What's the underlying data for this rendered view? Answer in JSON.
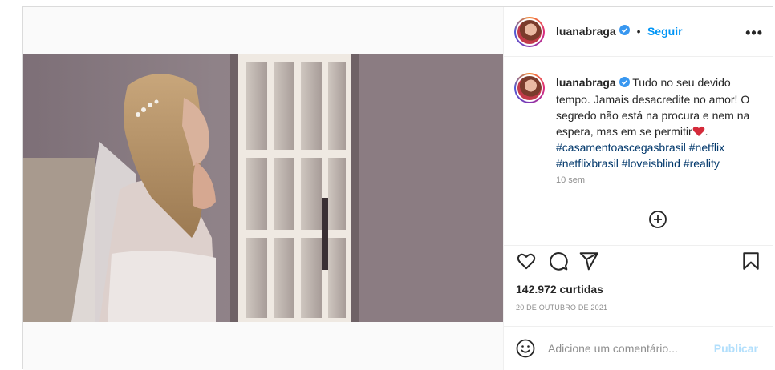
{
  "post": {
    "username": "luanabraga",
    "follow_separator": "•",
    "follow_label": "Seguir",
    "more_icon": "•••",
    "caption_user": "luanabraga",
    "caption_text": "Tudo no seu devido tempo. Jamais desacredite no amor! O segredo não está na procura e nem na espera, mas em se permitir",
    "caption_end": ".",
    "hashtags_line1": [
      "#casamentoascegasbrasil",
      "#netflix"
    ],
    "hashtags_line2": [
      "#netflixbrasil",
      "#loveisblind",
      "#reality"
    ],
    "time_ago": "10 sem",
    "likes": "142.972 curtidas",
    "date": "20 DE OUTUBRO DE 2021",
    "comment_placeholder": "Adicione um comentário...",
    "publish_label": "Publicar"
  },
  "icons": {
    "verified": "verified-badge-icon",
    "heart": "heart-icon",
    "comment": "comment-icon",
    "share": "share-icon",
    "save": "bookmark-icon",
    "add": "add-circle-icon",
    "emoji": "emoji-icon",
    "caption_emoji": "red-heart-emoji"
  },
  "colors": {
    "link_blue": "#0095f6",
    "hashtag_blue": "#00376b",
    "verified_blue": "#3897f0",
    "muted": "#8e8e8e",
    "publish_disabled": "#b2dffc"
  }
}
